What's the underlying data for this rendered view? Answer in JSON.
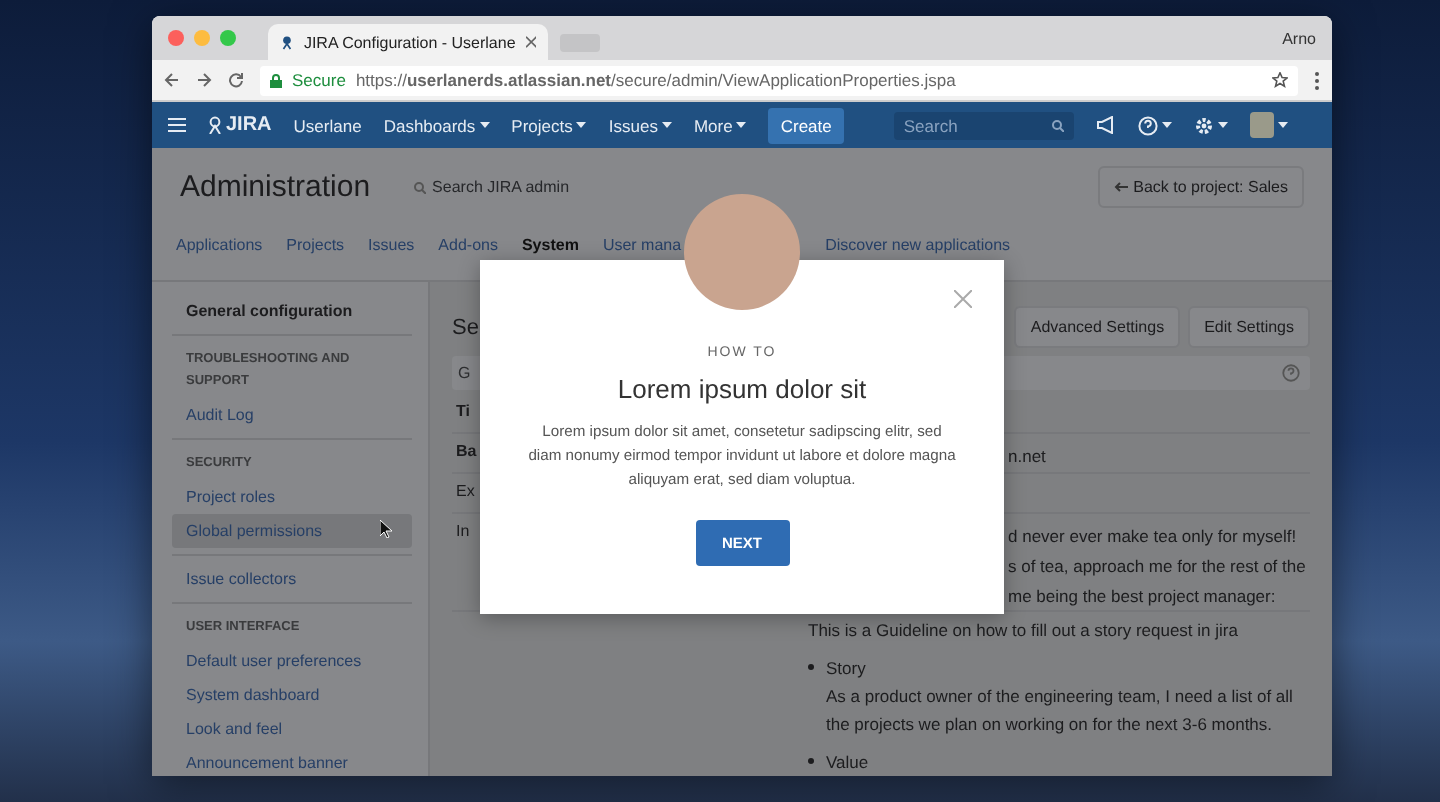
{
  "browser": {
    "tab_title": "JIRA Configuration - Userlane",
    "user": "Arno",
    "secure_label": "Secure",
    "url": "https://**userlanerds.atlassian.net**/secure/admin/ViewApplicationProperties.jspa"
  },
  "nav": {
    "logo": "JIRA",
    "items": [
      {
        "label": "Userlane",
        "dropdown": false
      },
      {
        "label": "Dashboards",
        "dropdown": true
      },
      {
        "label": "Projects",
        "dropdown": true
      },
      {
        "label": "Issues",
        "dropdown": true
      },
      {
        "label": "More",
        "dropdown": true
      }
    ],
    "create": "Create",
    "search": {
      "placeholder": "Search"
    }
  },
  "admin": {
    "title": "Administration",
    "search": {
      "placeholder": "Search JIRA admin"
    },
    "back": "Back to project: Sales"
  },
  "subtabs": [
    {
      "label": "Applications",
      "selected": false
    },
    {
      "label": "Projects",
      "selected": false
    },
    {
      "label": "Issues",
      "selected": false
    },
    {
      "label": "Add-ons",
      "selected": false
    },
    {
      "label": "System",
      "selected": true
    },
    {
      "label": "User mana",
      "selected": false
    },
    {
      "label": "Discover new applications",
      "selected": false
    }
  ],
  "sidebar": [
    {
      "kind": "title",
      "label": "General configuration"
    },
    {
      "kind": "divider"
    },
    {
      "kind": "heading",
      "label": "TROUBLESHOOTING AND SUPPORT"
    },
    {
      "kind": "link",
      "label": "Audit Log",
      "selected": false
    },
    {
      "kind": "divider"
    },
    {
      "kind": "heading",
      "label": "SECURITY"
    },
    {
      "kind": "link",
      "label": "Project roles",
      "selected": false
    },
    {
      "kind": "link",
      "label": "Global permissions",
      "selected": true
    },
    {
      "kind": "divider"
    },
    {
      "kind": "link",
      "label": "Issue collectors",
      "selected": false
    },
    {
      "kind": "divider"
    },
    {
      "kind": "heading",
      "label": "USER INTERFACE"
    },
    {
      "kind": "link",
      "label": "Default user preferences",
      "selected": false
    },
    {
      "kind": "link",
      "label": "System dashboard",
      "selected": false
    },
    {
      "kind": "link",
      "label": "Look and feel",
      "selected": false
    },
    {
      "kind": "link",
      "label": "Announcement banner",
      "selected": false
    }
  ],
  "main": {
    "heading": "Se",
    "buttons": [
      "Advanced Settings",
      "Edit Settings"
    ],
    "table_header": "G",
    "rows": [
      {
        "label": "Ti",
        "bold": true,
        "value_lines": []
      },
      {
        "label": "Ba",
        "bold": true,
        "value_lines": [
          "n.net"
        ]
      },
      {
        "label": "Ex",
        "bold": false,
        "value_lines": []
      },
      {
        "label": "In",
        "bold": false,
        "value_lines": [
          "d never ever make tea only for myself!",
          "s of tea, approach me for the rest of the",
          "me being the best project manager:"
        ]
      }
    ],
    "guideline": "This is a Guideline on how to fill out a story request in jira",
    "bullets": [
      {
        "title": "Story",
        "text": "As a product owner of the engineering team, I need a list of all the projects we plan on working on for the next 3-6 months."
      },
      {
        "title": "Value"
      }
    ]
  },
  "modal": {
    "eyebrow": "HOW TO",
    "title": "Lorem ipsum dolor sit",
    "body": "Lorem ipsum dolor sit amet, consetetur sadipscing elitr, sed diam nonumy eirmod tempor invidunt ut labore et dolore magna aliquyam erat, sed diam voluptua.",
    "button": "NEXT"
  }
}
